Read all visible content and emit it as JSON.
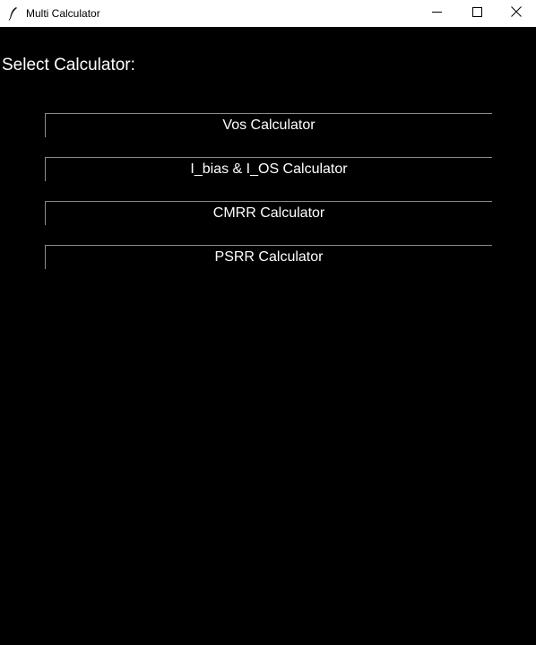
{
  "window": {
    "title": "Multi Calculator",
    "app_icon": "feather-icon",
    "controls": {
      "minimize_icon": "minimize-icon",
      "maximize_icon": "maximize-icon",
      "close_icon": "close-icon"
    }
  },
  "main": {
    "heading": "Select Calculator:",
    "buttons": [
      {
        "label": "Vos Calculator"
      },
      {
        "label": "I_bias & I_OS Calculator"
      },
      {
        "label": "CMRR Calculator"
      },
      {
        "label": "PSRR Calculator"
      }
    ]
  },
  "colors": {
    "background": "#000000",
    "text": "#ffffff",
    "button_border": "#8a8a8a",
    "titlebar": "#ffffff"
  }
}
